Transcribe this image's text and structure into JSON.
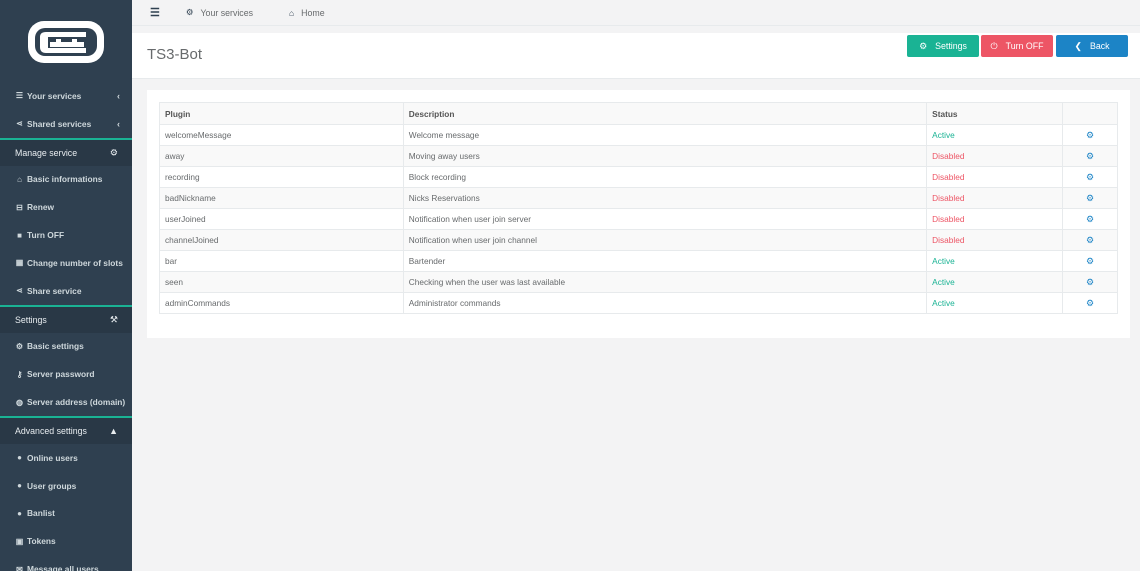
{
  "topbar": {
    "menu_icon": "bars-icon",
    "your_services": "Your services",
    "home": "Home"
  },
  "sidebar": {
    "items": [
      {
        "type": "item",
        "label": "Your services",
        "icon": "list-icon",
        "ico": "☰",
        "chevron": "‹"
      },
      {
        "type": "item",
        "label": "Shared services",
        "icon": "share-icon",
        "ico": "⋖",
        "chevron": "‹"
      },
      {
        "type": "header",
        "label": "Manage service",
        "icon": "gears-icon",
        "ico": "⚙"
      },
      {
        "type": "item",
        "label": "Basic informations",
        "icon": "home-icon",
        "ico": "⌂"
      },
      {
        "type": "item",
        "label": "Renew",
        "icon": "cart-icon",
        "ico": "⊟"
      },
      {
        "type": "item",
        "label": "Turn OFF",
        "icon": "stop-icon",
        "ico": "■"
      },
      {
        "type": "item",
        "label": "Change number of slots",
        "icon": "grid-icon",
        "ico": "▦"
      },
      {
        "type": "item",
        "label": "Share service",
        "icon": "share-icon",
        "ico": "⋖"
      },
      {
        "type": "header",
        "label": "Settings",
        "icon": "wrench-icon",
        "ico": "⚒"
      },
      {
        "type": "item",
        "label": "Basic settings",
        "icon": "gear-icon",
        "ico": "⚙"
      },
      {
        "type": "item",
        "label": "Server password",
        "icon": "key-icon",
        "ico": "⚷"
      },
      {
        "type": "item",
        "label": "Server address (domain)",
        "icon": "globe-icon",
        "ico": "◍"
      },
      {
        "type": "header",
        "label": "Advanced settings",
        "icon": "warning-icon",
        "ico": "▲"
      },
      {
        "type": "item",
        "label": "Online users",
        "icon": "user-icon",
        "ico": "●"
      },
      {
        "type": "item",
        "label": "User groups",
        "icon": "users-icon",
        "ico": "●"
      },
      {
        "type": "item",
        "label": "Banlist",
        "icon": "user-ban-icon",
        "ico": "●"
      },
      {
        "type": "item",
        "label": "Tokens",
        "icon": "lock-icon",
        "ico": "▣"
      },
      {
        "type": "item",
        "label": "Message all users",
        "icon": "envelope-icon",
        "ico": "✉"
      }
    ]
  },
  "page": {
    "title": "TS3-Bot",
    "buttons": {
      "settings": "Settings",
      "turn_off": "Turn OFF",
      "back": "Back"
    }
  },
  "table": {
    "headers": {
      "plugin": "Plugin",
      "description": "Description",
      "status": "Status",
      "actions": ""
    },
    "rows": [
      {
        "plugin": "welcomeMessage",
        "description": "Welcome message",
        "status": "Active"
      },
      {
        "plugin": "away",
        "description": "Moving away users",
        "status": "Disabled"
      },
      {
        "plugin": "recording",
        "description": "Block recording",
        "status": "Disabled"
      },
      {
        "plugin": "badNickname",
        "description": "Nicks Reservations",
        "status": "Disabled"
      },
      {
        "plugin": "userJoined",
        "description": "Notification when user join server",
        "status": "Disabled"
      },
      {
        "plugin": "channelJoined",
        "description": "Notification when user join channel",
        "status": "Disabled"
      },
      {
        "plugin": "bar",
        "description": "Bartender",
        "status": "Active"
      },
      {
        "plugin": "seen",
        "description": "Checking when the user was last available",
        "status": "Active"
      },
      {
        "plugin": "adminCommands",
        "description": "Administrator commands",
        "status": "Active"
      }
    ]
  },
  "colors": {
    "sidebar_bg": "#2f4050",
    "accent_green": "#1ab394",
    "danger_red": "#ed5565",
    "primary_blue": "#1c84c6"
  }
}
